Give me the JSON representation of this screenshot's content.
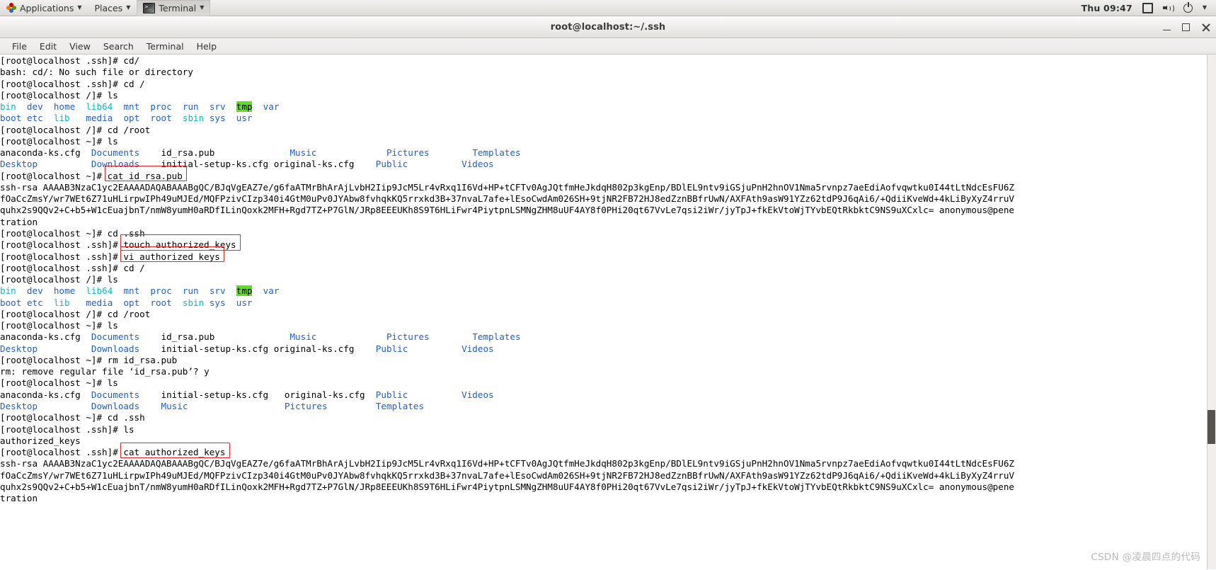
{
  "panel": {
    "applications": "Applications",
    "places": "Places",
    "terminal": "Terminal",
    "clock": "Thu 09:47",
    "icons": [
      "network-icon",
      "volume-icon",
      "power-icon",
      "chevron-down-icon"
    ]
  },
  "window": {
    "title": "root@localhost:~/.ssh",
    "minimize": "–",
    "maximize": "□",
    "close": "×"
  },
  "menubar": {
    "items": [
      "File",
      "Edit",
      "View",
      "Search",
      "Terminal",
      "Help"
    ]
  },
  "terminal": {
    "prompt_ssh": "[root@localhost .ssh]# ",
    "prompt_root": "[root@localhost ~]# ",
    "prompt_slash": "[root@localhost /]# ",
    "lines": [
      {
        "type": "cmd",
        "prompt": "[root@localhost .ssh]# ",
        "cmd": "cd/"
      },
      {
        "type": "out",
        "text": "bash: cd/: No such file or directory"
      },
      {
        "type": "cmd",
        "prompt": "[root@localhost .ssh]# ",
        "cmd": "cd /"
      },
      {
        "type": "cmd",
        "prompt": "[root@localhost /]# ",
        "cmd": "ls"
      },
      {
        "type": "lsroot1"
      },
      {
        "type": "lsroot2"
      },
      {
        "type": "cmd",
        "prompt": "[root@localhost /]# ",
        "cmd": "cd /root"
      },
      {
        "type": "cmd",
        "prompt": "[root@localhost ~]# ",
        "cmd": "ls"
      },
      {
        "type": "lshome1"
      },
      {
        "type": "lshome2"
      },
      {
        "type": "cmd",
        "prompt": "[root@localhost ~]# ",
        "cmd": "cat id_rsa.pub"
      },
      {
        "type": "key1"
      },
      {
        "type": "key2"
      },
      {
        "type": "key3"
      },
      {
        "type": "key4"
      },
      {
        "type": "cmd",
        "prompt": "[root@localhost ~]# ",
        "cmd": "cd .ssh"
      },
      {
        "type": "cmd",
        "prompt": "[root@localhost .ssh]# ",
        "cmd": "touch authorized_keys"
      },
      {
        "type": "cmd",
        "prompt": "[root@localhost .ssh]# ",
        "cmd": "vi authorized_keys"
      },
      {
        "type": "cmd",
        "prompt": "[root@localhost .ssh]# ",
        "cmd": "cd /"
      },
      {
        "type": "cmd",
        "prompt": "[root@localhost /]# ",
        "cmd": "ls"
      },
      {
        "type": "lsroot1"
      },
      {
        "type": "lsroot2"
      },
      {
        "type": "cmd",
        "prompt": "[root@localhost /]# ",
        "cmd": "cd /root"
      },
      {
        "type": "cmd",
        "prompt": "[root@localhost ~]# ",
        "cmd": "ls"
      },
      {
        "type": "lshome1"
      },
      {
        "type": "lshome2"
      },
      {
        "type": "cmd",
        "prompt": "[root@localhost ~]# ",
        "cmd": "rm id_rsa.pub"
      },
      {
        "type": "out",
        "text": "rm: remove regular file ‘id_rsa.pub’? y"
      },
      {
        "type": "cmd",
        "prompt": "[root@localhost ~]# ",
        "cmd": "ls"
      },
      {
        "type": "lshome3"
      },
      {
        "type": "lshome4"
      },
      {
        "type": "cmd",
        "prompt": "[root@localhost ~]# ",
        "cmd": "cd .ssh"
      },
      {
        "type": "cmd",
        "prompt": "[root@localhost .ssh]# ",
        "cmd": "ls"
      },
      {
        "type": "out",
        "text": "authorized_keys"
      },
      {
        "type": "cmd",
        "prompt": "[root@localhost .ssh]# ",
        "cmd": "cat authorized_keys"
      },
      {
        "type": "key1"
      },
      {
        "type": "key2"
      },
      {
        "type": "key3"
      },
      {
        "type": "key4"
      }
    ],
    "ls_root_row1": [
      {
        "t": "bin",
        "c": "lnk"
      },
      {
        "t": "dev",
        "c": "dir"
      },
      {
        "t": "home",
        "c": "dir"
      },
      {
        "t": "lib64",
        "c": "lnk"
      },
      {
        "t": "mnt",
        "c": "dir"
      },
      {
        "t": "proc",
        "c": "dir"
      },
      {
        "t": "run",
        "c": "dir"
      },
      {
        "t": "srv",
        "c": "dir"
      },
      {
        "t": "tmp",
        "c": "tmpdir"
      },
      {
        "t": "var",
        "c": "dir"
      }
    ],
    "ls_root_row2": [
      {
        "t": "boot",
        "c": "dir"
      },
      {
        "t": "etc",
        "c": "dir"
      },
      {
        "t": "lib",
        "c": "lnk"
      },
      {
        "t": "media",
        "c": "dir"
      },
      {
        "t": "opt",
        "c": "dir"
      },
      {
        "t": "root",
        "c": "dir"
      },
      {
        "t": "sbin",
        "c": "lnk"
      },
      {
        "t": "sys",
        "c": "dir"
      },
      {
        "t": "usr",
        "c": "dir"
      }
    ],
    "ls_home_row1": [
      {
        "t": "anaconda-ks.cfg",
        "c": "plain"
      },
      {
        "t": "Documents",
        "c": "dir"
      },
      {
        "t": "id_rsa.pub",
        "c": "plain"
      },
      {
        "t": "Music",
        "c": "dir"
      },
      {
        "t": "Pictures",
        "c": "dir"
      },
      {
        "t": "Templates",
        "c": "dir"
      }
    ],
    "ls_home_row2": [
      {
        "t": "Desktop",
        "c": "dir"
      },
      {
        "t": "Downloads",
        "c": "dir"
      },
      {
        "t": "initial-setup-ks.cfg",
        "c": "plain"
      },
      {
        "t": "original-ks.cfg",
        "c": "plain"
      },
      {
        "t": "Public",
        "c": "dir"
      },
      {
        "t": "Videos",
        "c": "dir"
      }
    ],
    "ls_home_row3": [
      {
        "t": "anaconda-ks.cfg",
        "c": "plain"
      },
      {
        "t": "Documents",
        "c": "dir"
      },
      {
        "t": "initial-setup-ks.cfg",
        "c": "plain"
      },
      {
        "t": "original-ks.cfg",
        "c": "plain"
      },
      {
        "t": "Public",
        "c": "dir"
      },
      {
        "t": "Videos",
        "c": "dir"
      }
    ],
    "ls_home_row4": [
      {
        "t": "Desktop",
        "c": "dir"
      },
      {
        "t": "Downloads",
        "c": "dir"
      },
      {
        "t": "Music",
        "c": "dir"
      },
      {
        "t": "Pictures",
        "c": "dir"
      },
      {
        "t": "Templates",
        "c": "dir"
      }
    ],
    "ssh_key": [
      "ssh-rsa AAAAB3NzaC1yc2EAAAADAQABAAABgQC/BJqVgEAZ7e/g6faATMrBhArAjLvbH2Iip9JcM5Lr4vRxq1I6Vd+HP+tCFTv0AgJQtfmHeJkdqH802p3kgEnp/BDlEL9ntv9iGSjuPnH2hnOV1Nma5rvnpz7aeEdiAofvqwtku0I44tLtNdcEsFU6Z",
      "fOaCcZmsY/wr7WEt6Z71uHLirpwIPh49uMJEd/MQFPzivCIzp340i4GtM0uPv0JYAbw8fvhqkKQ5rrxkd3B+37nvaL7afe+lEsoCwdAm026SH+9tjNR2FB72HJ8edZznBBfrUwN/AXFAth9asW91YZz62tdP9J6qAi6/+QdiiKveWd+4kLiByXyZ4rruV",
      "quhx2s9QQv2+C+b5+W1cEuajbnT/nmW8yumH0aRDfILinQoxk2MFH+Rgd7TZ+P7GlN/JRp8EEEUKh8S9T6HLiFwr4PiytpnLSMNgZHM8uUF4AY8f0PHi20qt67VvLe7qsi2iWr/jyTpJ+fkEkVtoWjTYvbEQtRkbktC9NS9uXCxlc= anonymous@pene",
      "tration"
    ]
  },
  "annotations": {
    "boxes": [
      "cat id_rsa.pub",
      "touch authorized_keys",
      "vi authorized_keys",
      "cat authorized_keys"
    ],
    "box_color": "#e8252a"
  },
  "watermark": "CSDN @凌晨四点的代码"
}
